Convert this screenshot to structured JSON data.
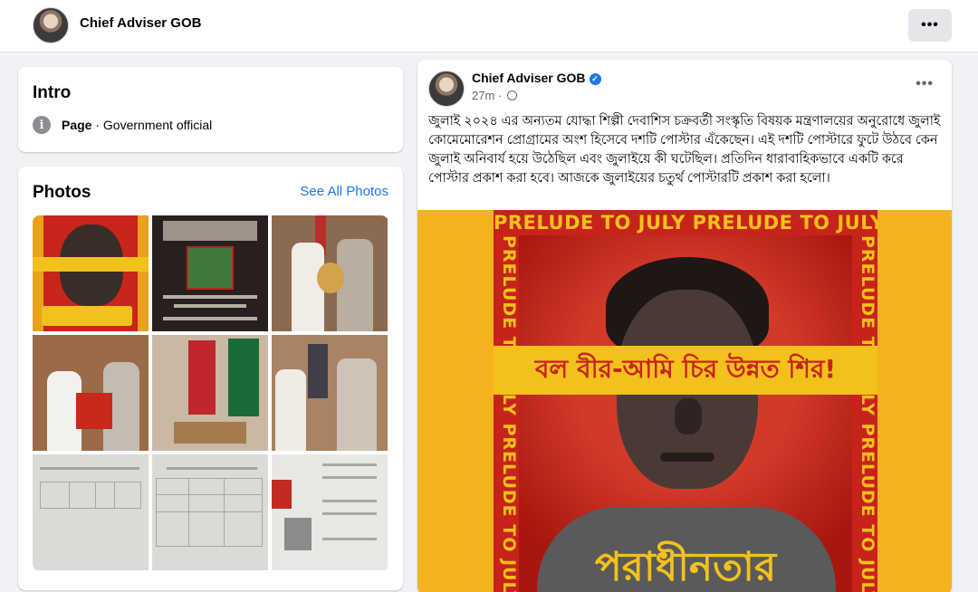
{
  "header": {
    "page_name": "Chief Adviser GOB",
    "more_label": "•••"
  },
  "intro": {
    "title": "Intro",
    "category_label": "Page",
    "category_value": " · Government official"
  },
  "photos": {
    "title": "Photos",
    "see_all": "See All Photos"
  },
  "post": {
    "author": "Chief Adviser GOB",
    "time": "27m",
    "dot": " · ",
    "more_label": "•••",
    "text": "জুলাই ২০২৪ এর অন্যতম যোদ্ধা শিল্পী দেবাশিস চক্রবর্তী সংস্কৃতি বিষয়ক মন্ত্রণালয়ের অনুরোধে জুলাই কোমেমোরেশন প্রোগ্রামের অংশ হিসেবে দশটি পোস্টার এঁকেছেন। এই দশটি পোস্টারে ফুটে উঠবে কেন জুলাই অনিবার্য হয়ে উঠেছিল এবং জুলাইয়ে কী ঘটেছিল। প্রতিদিন ধারাবাহিকভাবে একটি করে পোস্টার প্রকাশ করা হবে। আজকে জুলাইয়ের চতুর্থ পোস্টারটি প্রকাশ করা হলো।",
    "poster": {
      "top_text": "PRELUDE TO JULY PRELUDE TO JULY",
      "left_text": "PRELUDE TO JULY PRELUDE TO JULY",
      "right_text": "PRELUDE TO JULY PRELUDE TO JULY",
      "band_text": "বল বীর-আমি চির উন্নত শির!",
      "bottom_text": "পরাধীনতার"
    }
  },
  "colors": {
    "accent": "#1877f2",
    "poster_red": "#c8231b",
    "poster_yellow": "#f3c11b",
    "background": "#f0f2f5"
  }
}
